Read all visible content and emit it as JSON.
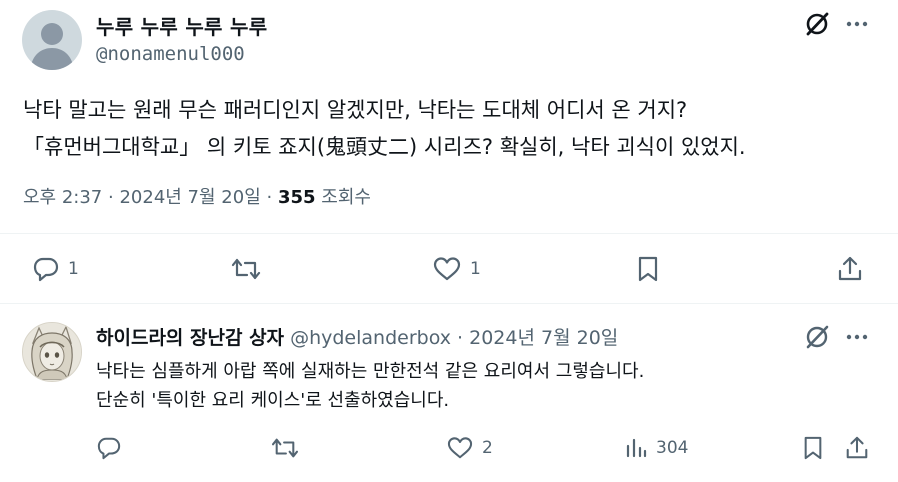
{
  "tweet": {
    "display_name": "누루 누루 누루 누루",
    "handle": "@nonamenul000",
    "text": "낙타 말고는 원래 무슨 패러디인지 알겠지만, 낙타는 도대체 어디서 온 거지?\n「휴먼버그대학교」 의 키토 죠지(鬼頭丈二) 시리즈? 확실히, 낙타 괴식이 있었지.",
    "time": "오후 2:37",
    "sep1": "·",
    "date": "2024년 7월 20일",
    "sep2": "·",
    "views": "355",
    "views_label": "조회수",
    "reply_count": "1",
    "retweet_count": "",
    "like_count": "1"
  },
  "reply": {
    "display_name": "하이드라의 장난감 상자",
    "handle": "@hydelanderbox",
    "sep": "·",
    "date": "2024년 7월 20일",
    "text": "낙타는 심플하게 아랍 쪽에 실재하는 만한전석 같은 요리여서 그렇습니다.\n단순히 '특이한 요리 케이스'로 선출하였습니다.",
    "reply_count": "",
    "retweet_count": "",
    "like_count": "2",
    "view_count": "304"
  },
  "icons": {
    "grok": "grok-icon",
    "more": "more-icon",
    "reply": "reply-icon",
    "retweet": "retweet-icon",
    "like": "heart-icon",
    "bookmark": "bookmark-icon",
    "share": "share-icon",
    "views": "views-icon"
  },
  "colors": {
    "text": "#0f1419",
    "secondary": "#536471",
    "divider": "#eff3f4"
  }
}
